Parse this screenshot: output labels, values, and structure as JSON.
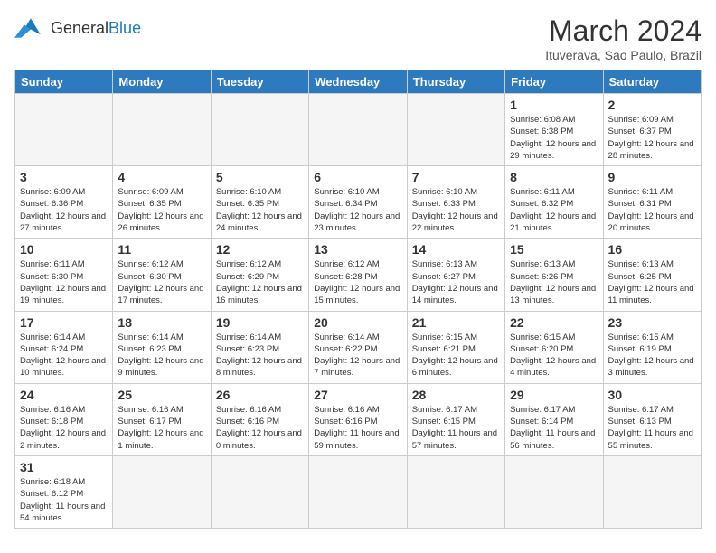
{
  "header": {
    "logo_general": "General",
    "logo_blue": "Blue",
    "month_year": "March 2024",
    "location": "Ituverava, Sao Paulo, Brazil"
  },
  "weekdays": [
    "Sunday",
    "Monday",
    "Tuesday",
    "Wednesday",
    "Thursday",
    "Friday",
    "Saturday"
  ],
  "weeks": [
    [
      {
        "day": "",
        "info": ""
      },
      {
        "day": "",
        "info": ""
      },
      {
        "day": "",
        "info": ""
      },
      {
        "day": "",
        "info": ""
      },
      {
        "day": "",
        "info": ""
      },
      {
        "day": "1",
        "info": "Sunrise: 6:08 AM\nSunset: 6:38 PM\nDaylight: 12 hours and 29 minutes."
      },
      {
        "day": "2",
        "info": "Sunrise: 6:09 AM\nSunset: 6:37 PM\nDaylight: 12 hours and 28 minutes."
      }
    ],
    [
      {
        "day": "3",
        "info": "Sunrise: 6:09 AM\nSunset: 6:36 PM\nDaylight: 12 hours and 27 minutes."
      },
      {
        "day": "4",
        "info": "Sunrise: 6:09 AM\nSunset: 6:35 PM\nDaylight: 12 hours and 26 minutes."
      },
      {
        "day": "5",
        "info": "Sunrise: 6:10 AM\nSunset: 6:35 PM\nDaylight: 12 hours and 24 minutes."
      },
      {
        "day": "6",
        "info": "Sunrise: 6:10 AM\nSunset: 6:34 PM\nDaylight: 12 hours and 23 minutes."
      },
      {
        "day": "7",
        "info": "Sunrise: 6:10 AM\nSunset: 6:33 PM\nDaylight: 12 hours and 22 minutes."
      },
      {
        "day": "8",
        "info": "Sunrise: 6:11 AM\nSunset: 6:32 PM\nDaylight: 12 hours and 21 minutes."
      },
      {
        "day": "9",
        "info": "Sunrise: 6:11 AM\nSunset: 6:31 PM\nDaylight: 12 hours and 20 minutes."
      }
    ],
    [
      {
        "day": "10",
        "info": "Sunrise: 6:11 AM\nSunset: 6:30 PM\nDaylight: 12 hours and 19 minutes."
      },
      {
        "day": "11",
        "info": "Sunrise: 6:12 AM\nSunset: 6:30 PM\nDaylight: 12 hours and 17 minutes."
      },
      {
        "day": "12",
        "info": "Sunrise: 6:12 AM\nSunset: 6:29 PM\nDaylight: 12 hours and 16 minutes."
      },
      {
        "day": "13",
        "info": "Sunrise: 6:12 AM\nSunset: 6:28 PM\nDaylight: 12 hours and 15 minutes."
      },
      {
        "day": "14",
        "info": "Sunrise: 6:13 AM\nSunset: 6:27 PM\nDaylight: 12 hours and 14 minutes."
      },
      {
        "day": "15",
        "info": "Sunrise: 6:13 AM\nSunset: 6:26 PM\nDaylight: 12 hours and 13 minutes."
      },
      {
        "day": "16",
        "info": "Sunrise: 6:13 AM\nSunset: 6:25 PM\nDaylight: 12 hours and 11 minutes."
      }
    ],
    [
      {
        "day": "17",
        "info": "Sunrise: 6:14 AM\nSunset: 6:24 PM\nDaylight: 12 hours and 10 minutes."
      },
      {
        "day": "18",
        "info": "Sunrise: 6:14 AM\nSunset: 6:23 PM\nDaylight: 12 hours and 9 minutes."
      },
      {
        "day": "19",
        "info": "Sunrise: 6:14 AM\nSunset: 6:23 PM\nDaylight: 12 hours and 8 minutes."
      },
      {
        "day": "20",
        "info": "Sunrise: 6:14 AM\nSunset: 6:22 PM\nDaylight: 12 hours and 7 minutes."
      },
      {
        "day": "21",
        "info": "Sunrise: 6:15 AM\nSunset: 6:21 PM\nDaylight: 12 hours and 6 minutes."
      },
      {
        "day": "22",
        "info": "Sunrise: 6:15 AM\nSunset: 6:20 PM\nDaylight: 12 hours and 4 minutes."
      },
      {
        "day": "23",
        "info": "Sunrise: 6:15 AM\nSunset: 6:19 PM\nDaylight: 12 hours and 3 minutes."
      }
    ],
    [
      {
        "day": "24",
        "info": "Sunrise: 6:16 AM\nSunset: 6:18 PM\nDaylight: 12 hours and 2 minutes."
      },
      {
        "day": "25",
        "info": "Sunrise: 6:16 AM\nSunset: 6:17 PM\nDaylight: 12 hours and 1 minute."
      },
      {
        "day": "26",
        "info": "Sunrise: 6:16 AM\nSunset: 6:16 PM\nDaylight: 12 hours and 0 minutes."
      },
      {
        "day": "27",
        "info": "Sunrise: 6:16 AM\nSunset: 6:16 PM\nDaylight: 11 hours and 59 minutes."
      },
      {
        "day": "28",
        "info": "Sunrise: 6:17 AM\nSunset: 6:15 PM\nDaylight: 11 hours and 57 minutes."
      },
      {
        "day": "29",
        "info": "Sunrise: 6:17 AM\nSunset: 6:14 PM\nDaylight: 11 hours and 56 minutes."
      },
      {
        "day": "30",
        "info": "Sunrise: 6:17 AM\nSunset: 6:13 PM\nDaylight: 11 hours and 55 minutes."
      }
    ],
    [
      {
        "day": "31",
        "info": "Sunrise: 6:18 AM\nSunset: 6:12 PM\nDaylight: 11 hours and 54 minutes."
      },
      {
        "day": "",
        "info": ""
      },
      {
        "day": "",
        "info": ""
      },
      {
        "day": "",
        "info": ""
      },
      {
        "day": "",
        "info": ""
      },
      {
        "day": "",
        "info": ""
      },
      {
        "day": "",
        "info": ""
      }
    ]
  ]
}
